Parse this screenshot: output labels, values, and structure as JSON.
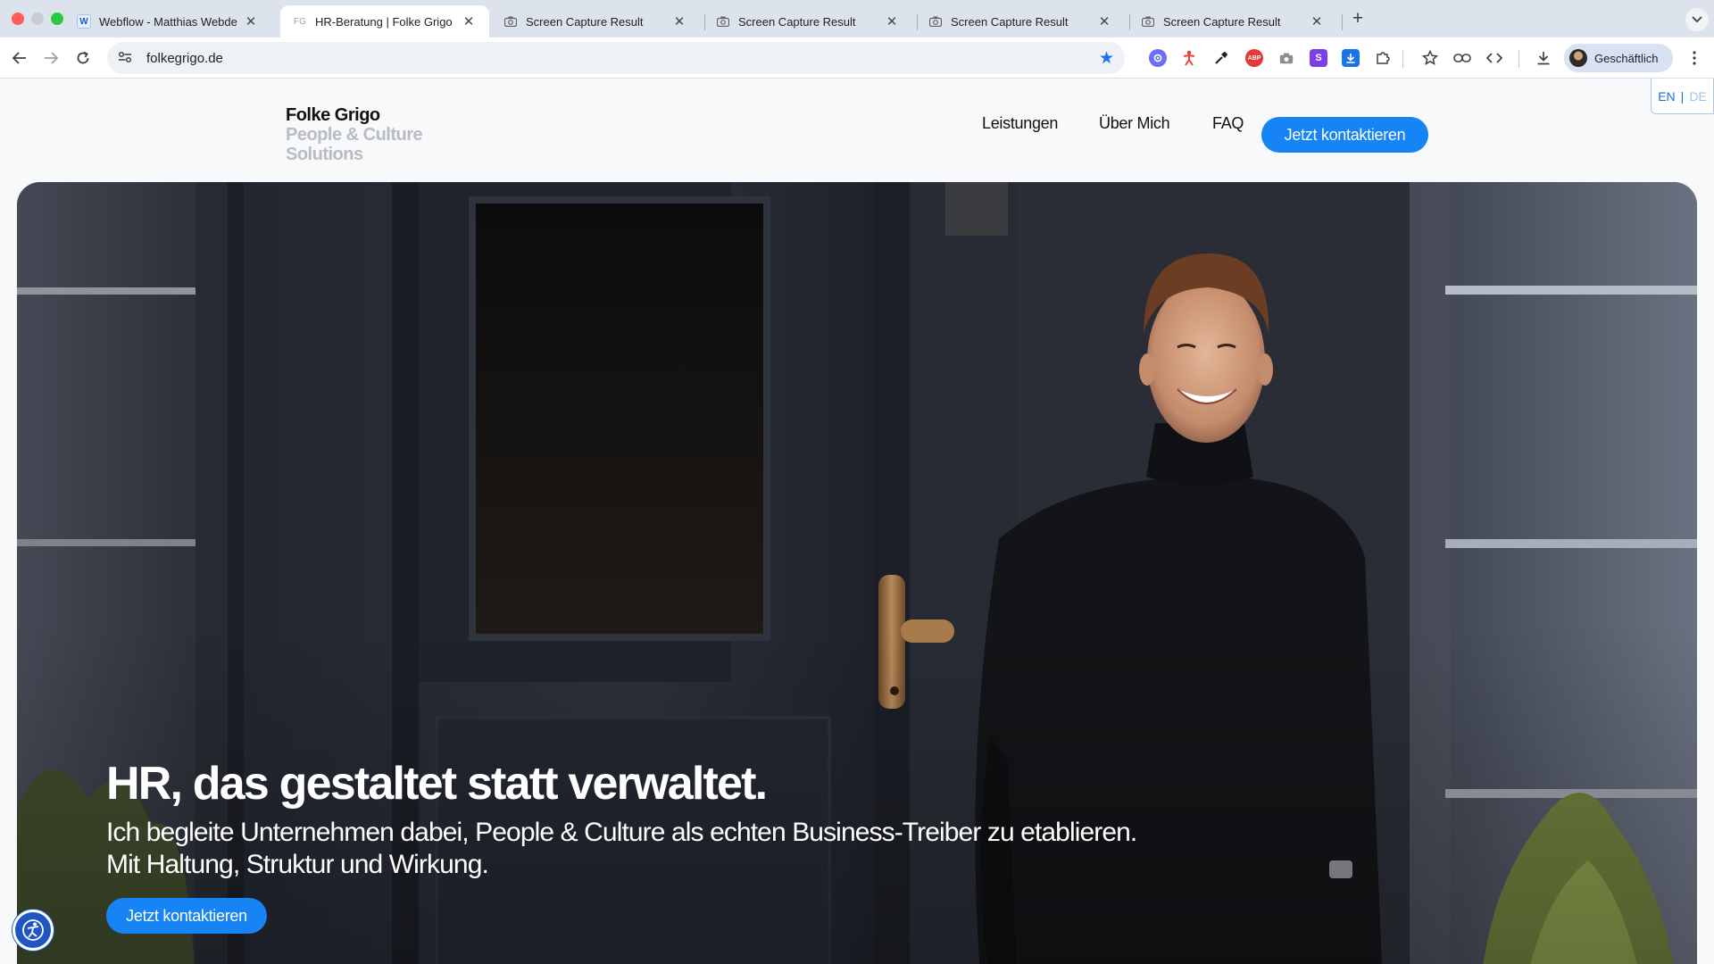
{
  "browser": {
    "tabs": [
      {
        "title": "Webflow - Matthias Webdesign",
        "favicon": "webflow-icon",
        "active": false
      },
      {
        "title": "HR-Beratung | Folke Grigo People & Culture",
        "favicon": "folke-grigo-favicon",
        "favicon_text": "FG",
        "active": true
      },
      {
        "title": "Screen Capture Result",
        "favicon": "camera-icon",
        "active": false
      },
      {
        "title": "Screen Capture Result",
        "favicon": "camera-icon",
        "active": false
      },
      {
        "title": "Screen Capture Result",
        "favicon": "camera-icon",
        "active": false
      },
      {
        "title": "Screen Capture Result",
        "favicon": "camera-icon",
        "active": false
      }
    ],
    "url": "folkegrigo.de",
    "profile_name": "Geschäftlich",
    "accent_color": "#1a73e8"
  },
  "site": {
    "logo": {
      "line1": "Folke Grigo",
      "line2": "People & Culture",
      "line3": "Solutions"
    },
    "nav": {
      "leistungen": "Leistungen",
      "ueber_mich": "Über Mich",
      "faq": "FAQ",
      "cta": "Jetzt kontaktieren"
    },
    "lang": {
      "en": "EN",
      "separator": "|",
      "de": "DE"
    },
    "hero": {
      "title": "HR, das gestaltet statt verwaltet.",
      "subtitle_line1": "Ich begleite Unternehmen dabei, People & Culture als echten Business-Treiber zu etablieren.",
      "subtitle_line2": "Mit Haltung, Struktur und Wirkung.",
      "cta": "Jetzt kontaktieren"
    },
    "brand_color": "#1684f5"
  }
}
